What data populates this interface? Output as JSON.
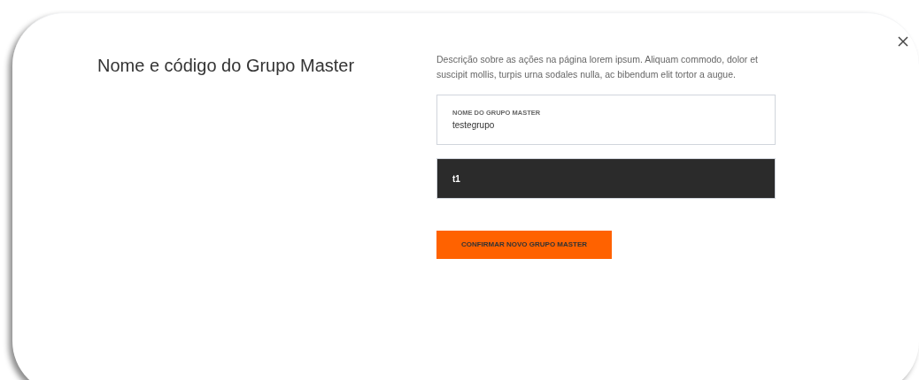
{
  "dialog": {
    "title": "Nome e código do Grupo Master",
    "description": "Descrição sobre as ações na página lorem ipsum. Aliquam commodo, dolor et suscipit mollis, turpis urna sodales nulla, ac bibendum elit tortor a augue.",
    "fields": [
      {
        "label": "NOME DO GRUPO MASTER",
        "value": "testegrupo",
        "focused": false
      },
      {
        "value": "t1",
        "focused": true
      }
    ],
    "confirm_button": "CONFIRMAR NOVO GRUPO MASTER"
  }
}
